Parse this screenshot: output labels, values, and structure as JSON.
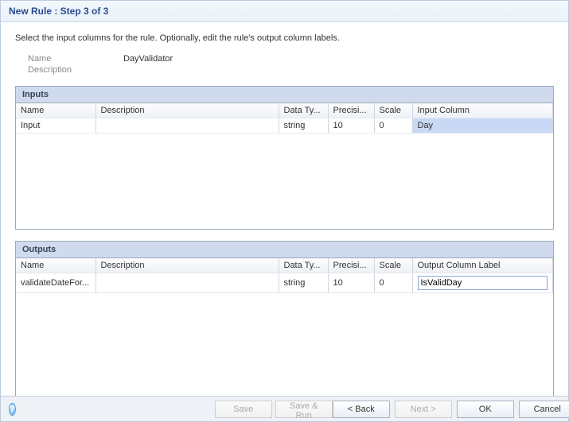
{
  "window": {
    "title": "New Rule : Step 3 of 3"
  },
  "instruction": "Select the input columns for the rule. Optionally, edit the rule's output column labels.",
  "fields": {
    "name_label": "Name",
    "name_value": "DayValidator",
    "desc_label": "Description",
    "desc_value": ""
  },
  "inputs": {
    "title": "Inputs",
    "headers": {
      "name": "Name",
      "description": "Description",
      "data_type": "Data Ty...",
      "precision": "Precisi...",
      "scale": "Scale",
      "input_column": "Input Column"
    },
    "rows": [
      {
        "name": "Input",
        "description": "",
        "data_type": "string",
        "precision": "10",
        "scale": "0",
        "input_column": "Day",
        "selected": true
      }
    ]
  },
  "outputs": {
    "title": "Outputs",
    "headers": {
      "name": "Name",
      "description": "Description",
      "data_type": "Data Ty...",
      "precision": "Precisi...",
      "scale": "Scale",
      "output_label": "Output Column Label"
    },
    "rows": [
      {
        "name": "validateDateFor...",
        "description": "",
        "data_type": "string",
        "precision": "10",
        "scale": "0",
        "output_label": "IsValidDay",
        "editing": true
      }
    ]
  },
  "buttons": {
    "save": "Save",
    "save_run": "Save & Run",
    "back": "< Back",
    "next": "Next >",
    "ok": "OK",
    "cancel": "Cancel"
  },
  "help_glyph": "?"
}
